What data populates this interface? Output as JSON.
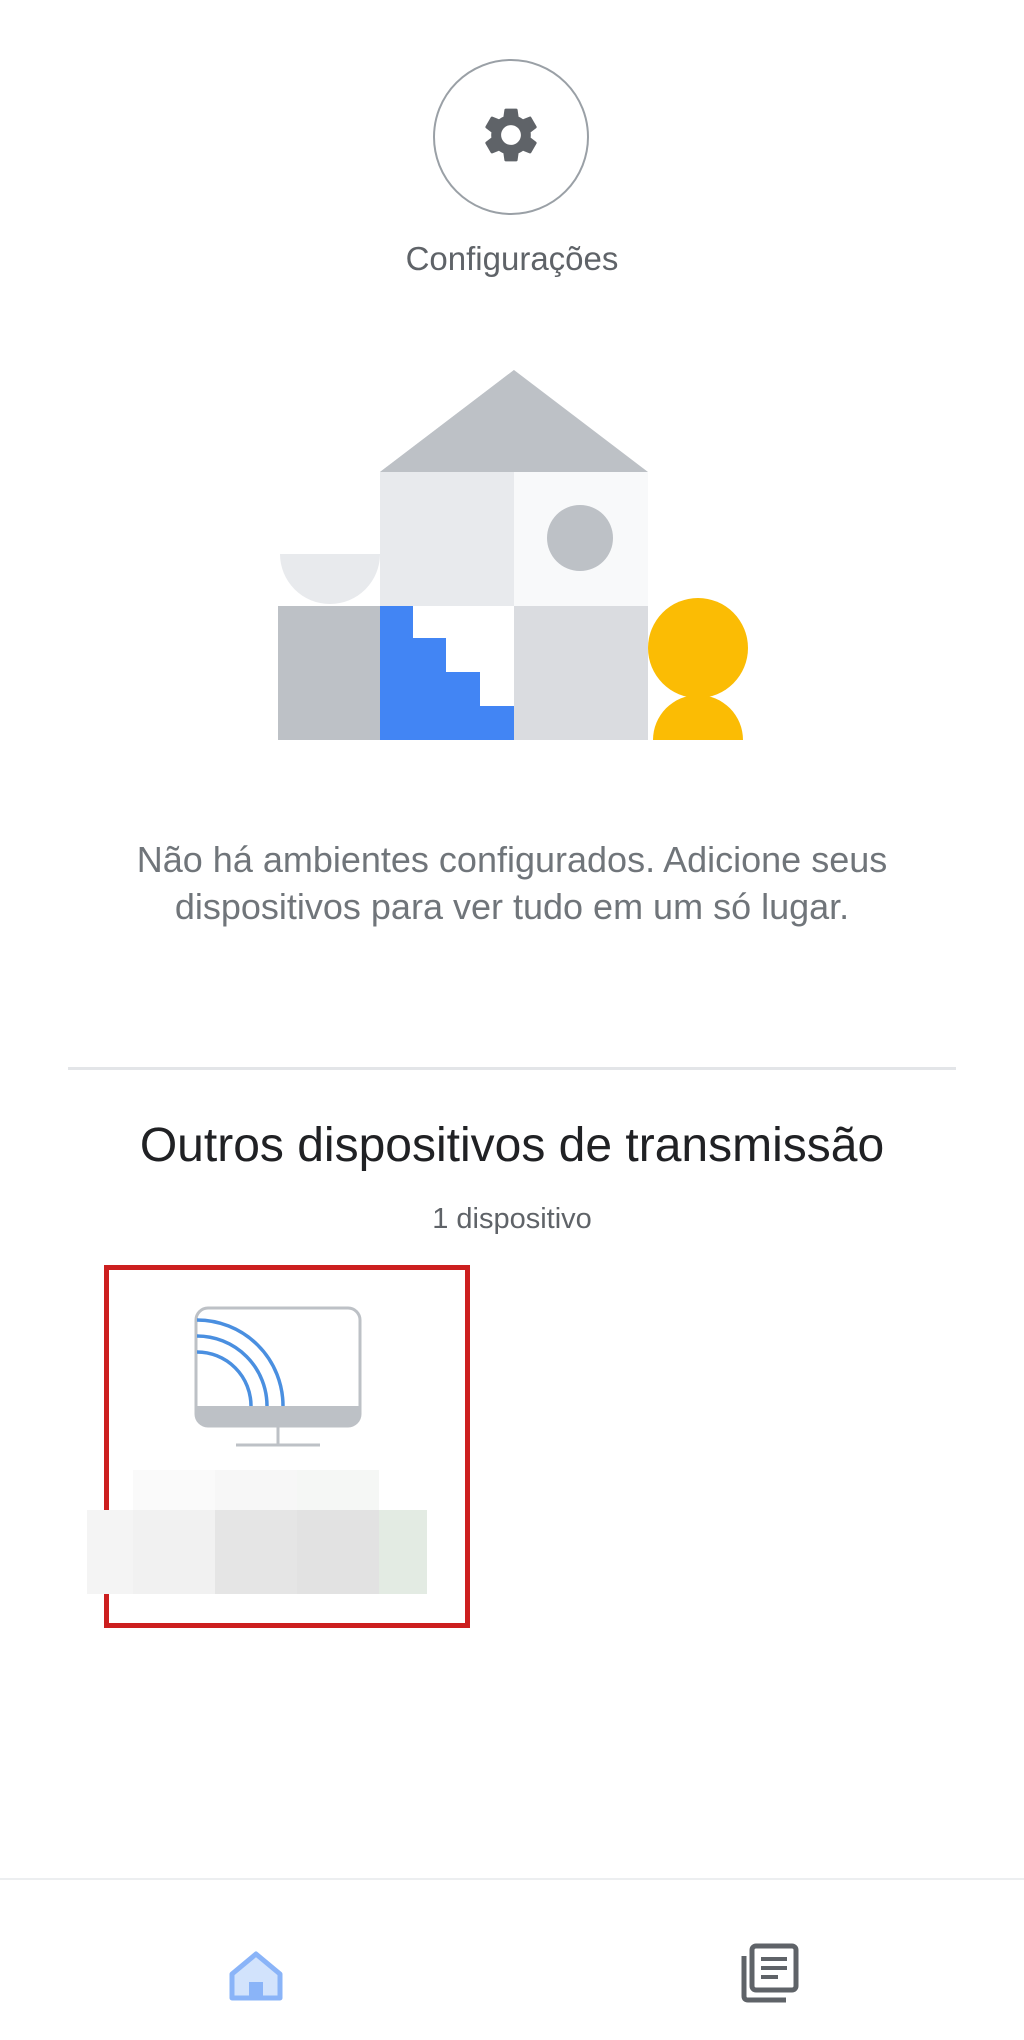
{
  "settings": {
    "label": "Configurações",
    "icon": "gear-icon"
  },
  "empty_state": {
    "message": "Não há ambientes configurados. Adicione seus dispositivos para ver tudo em um só lugar."
  },
  "cast_section": {
    "title": "Outros dispositivos de transmissão",
    "count": "1 dispositivo",
    "device": {
      "icon": "tv-cast-icon",
      "name_redacted": true
    }
  },
  "bottom_nav": {
    "items": [
      {
        "id": "home",
        "icon": "home-icon",
        "active": true
      },
      {
        "id": "feed",
        "icon": "feed-icon",
        "active": false
      }
    ]
  },
  "colors": {
    "highlight_border": "#cc1f1f",
    "active_nav": "#8ab4f8",
    "accent_blue": "#4285f4",
    "accent_yellow": "#fbbc04"
  }
}
